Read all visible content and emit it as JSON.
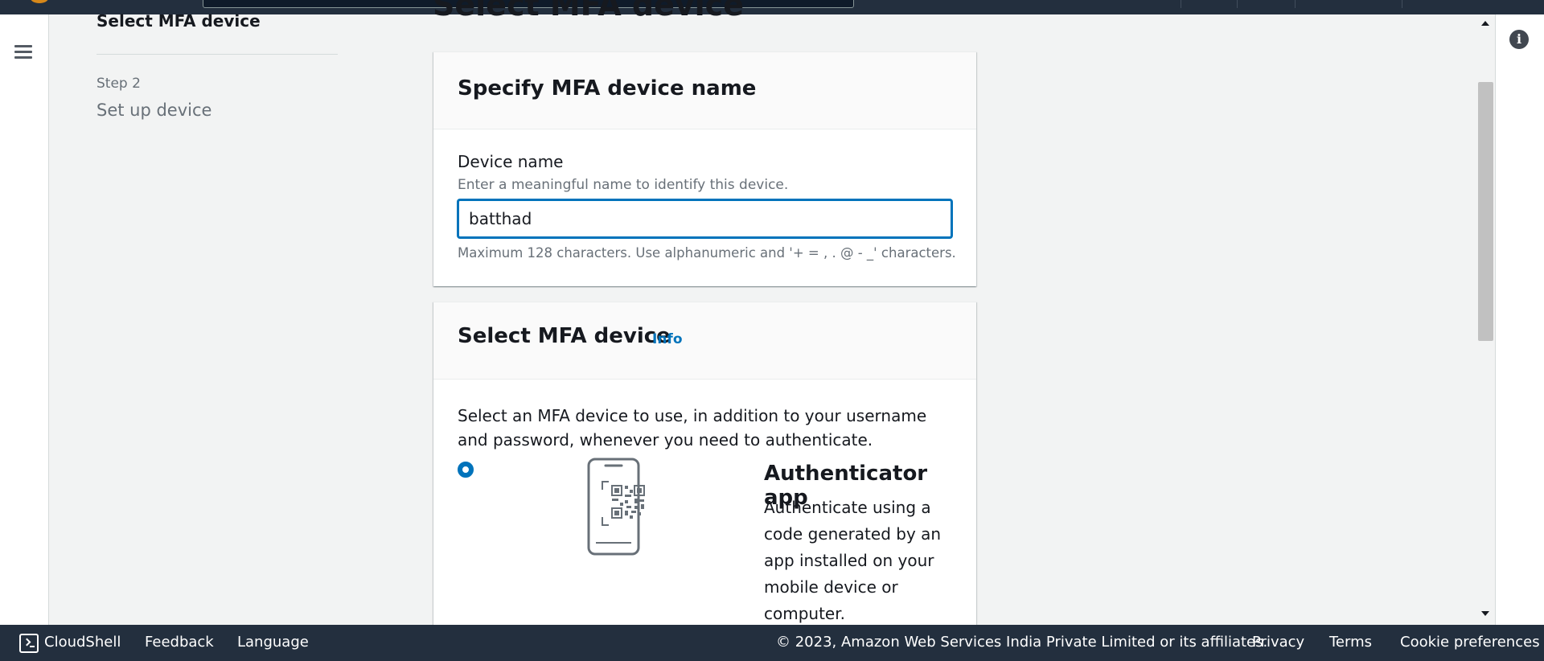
{
  "wizard": {
    "current_step_title": "Select MFA device",
    "step2_number": "Step 2",
    "step2_name": "Set up device"
  },
  "page": {
    "heading": "Select MFA device"
  },
  "device_name_card": {
    "title": "Specify MFA device name",
    "field_label": "Device name",
    "field_description": "Enter a meaningful name to identify this device.",
    "field_value": "batthad",
    "constraint_text": "Maximum 128 characters. Use alphanumeric and '+ = , . @ - _' characters."
  },
  "mfa_device_card": {
    "title": "Select MFA device",
    "info_link": "Info",
    "description": "Select an MFA device to use, in addition to your username and password, whenever you need to authenticate.",
    "options": [
      {
        "title": "Authenticator app",
        "description": "Authenticate using a code generated by an app installed on your mobile device or computer.",
        "selected": true,
        "icon": "phone-qr-code-icon"
      }
    ]
  },
  "footer": {
    "cloudshell": "CloudShell",
    "feedback": "Feedback",
    "language": "Language",
    "copyright": "© 2023, Amazon Web Services India Private Limited or its affiliates.",
    "privacy": "Privacy",
    "terms": "Terms",
    "cookie_preferences": "Cookie preferences"
  },
  "colors": {
    "accent": "#0073bb",
    "nav_bg": "#232f3e",
    "page_bg": "#f2f3f3"
  }
}
